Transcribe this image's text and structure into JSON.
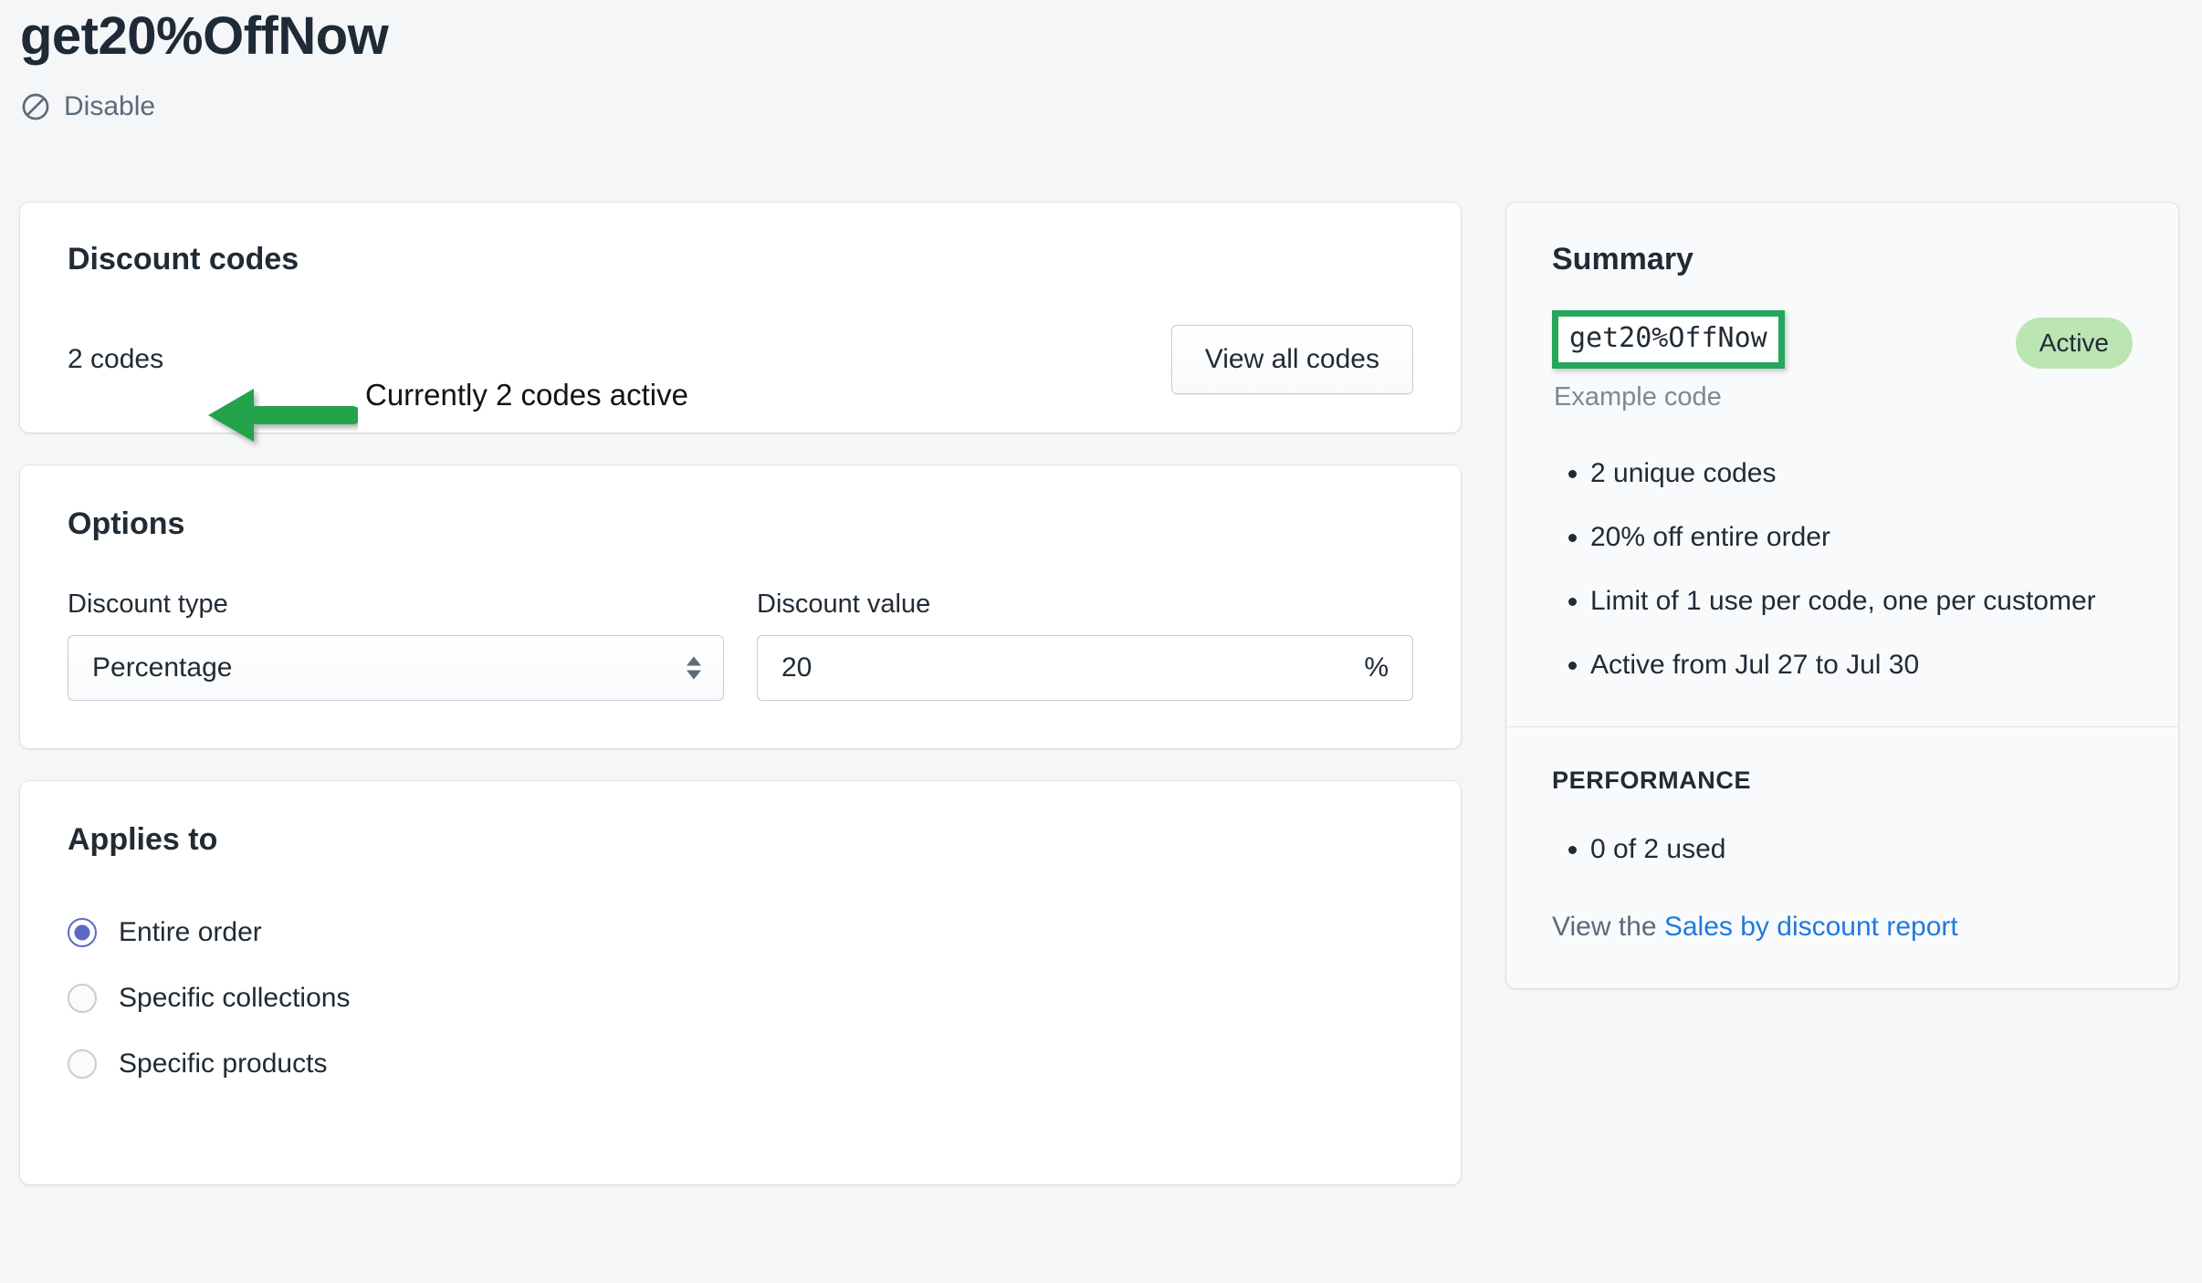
{
  "header": {
    "title": "get20%OffNow",
    "disable_label": "Disable",
    "disable_icon": "prohibition-icon"
  },
  "discount_codes_card": {
    "title": "Discount codes",
    "codes_count": "2 codes",
    "view_all_label": "View all codes"
  },
  "options_card": {
    "title": "Options",
    "discount_type": {
      "label": "Discount type",
      "value": "Percentage"
    },
    "discount_value": {
      "label": "Discount value",
      "value": "20",
      "suffix": "%"
    }
  },
  "applies_to_card": {
    "title": "Applies to",
    "options": [
      {
        "label": "Entire order",
        "selected": true
      },
      {
        "label": "Specific collections",
        "selected": false
      },
      {
        "label": "Specific products",
        "selected": false
      }
    ]
  },
  "summary": {
    "title": "Summary",
    "code": "get20%OffNow",
    "code_caption": "Example code",
    "status_badge": "Active",
    "bullets": [
      "2 unique codes",
      "20% off entire order",
      "Limit of 1 use per code, one per customer",
      "Active from Jul 27 to Jul 30"
    ]
  },
  "performance": {
    "title": "PERFORMANCE",
    "bullets": [
      "0 of 2 used"
    ],
    "footer_prefix": "View the ",
    "footer_link": "Sales by discount report"
  },
  "annotation": {
    "note": "Currently 2 codes active",
    "arrow_color": "#22a34a",
    "highlight_color": "#26a65b"
  },
  "colors": {
    "page_background": "#f4f6f8",
    "card_background": "#ffffff",
    "summary_background": "#f9fafb",
    "text": "#212b36",
    "link": "#1f7ae0",
    "radio_selected": "#5c6ac4",
    "badge_background": "#bbe5b3"
  }
}
